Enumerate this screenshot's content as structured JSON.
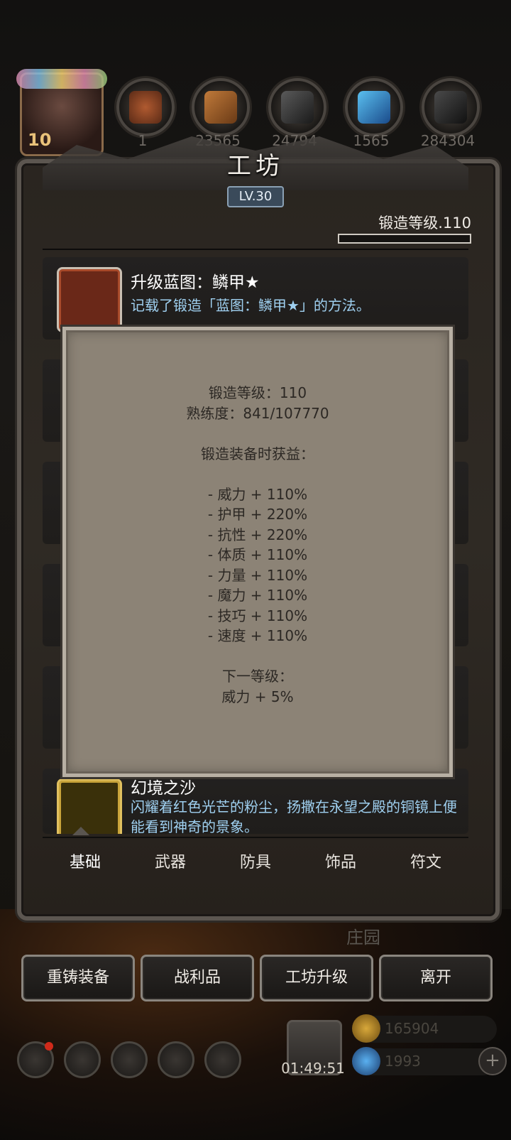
{
  "header": {
    "player_level": "10",
    "resources": [
      {
        "icon": "leather-icon",
        "value": "1",
        "color": "#8a4a2a"
      },
      {
        "icon": "wood-icon",
        "value": "23565",
        "color": "#8a5a2a"
      },
      {
        "icon": "iron-icon",
        "value": "24794",
        "color": "#3a3a3a"
      },
      {
        "icon": "crystal-icon",
        "value": "1565",
        "color": "#2a7ac0"
      },
      {
        "icon": "ore-icon",
        "value": "284304",
        "color": "#2a2a2a"
      }
    ]
  },
  "panel": {
    "title": "工坊",
    "level_badge": "LV.30",
    "forge_level": "锻造等级.110"
  },
  "items": [
    {
      "name": "升级蓝图：鳞甲★",
      "desc": "记载了锻造「蓝图：鳞甲★」的方法。"
    },
    {
      "name": "幻境之沙",
      "desc": "闪耀着红色光芒的粉尘，扬撒在永望之殿的铜镜上便能看到神奇的景象。"
    }
  ],
  "tooltip": {
    "forge_level": "锻造等级：110",
    "proficiency": "熟练度：841/107770",
    "bonus_header": "锻造装备时获益：",
    "bonuses": [
      "- 威力 + 110%",
      "- 护甲 + 220%",
      "- 抗性 + 220%",
      "- 体质 + 110%",
      "- 力量 + 110%",
      "- 魔力 + 110%",
      "- 技巧 + 110%",
      "- 速度 + 110%"
    ],
    "next_header": "下一等级：",
    "next_bonus": "威力 + 5%"
  },
  "tabs": [
    "基础",
    "武器",
    "防具",
    "饰品",
    "符文"
  ],
  "actions": [
    "重铸装备",
    "战利品",
    "工坊升级",
    "离开"
  ],
  "bottom": {
    "timer": "01:49:51",
    "gold": "165904",
    "gems": "1993",
    "plus": "+",
    "faint_label": "庄园"
  }
}
